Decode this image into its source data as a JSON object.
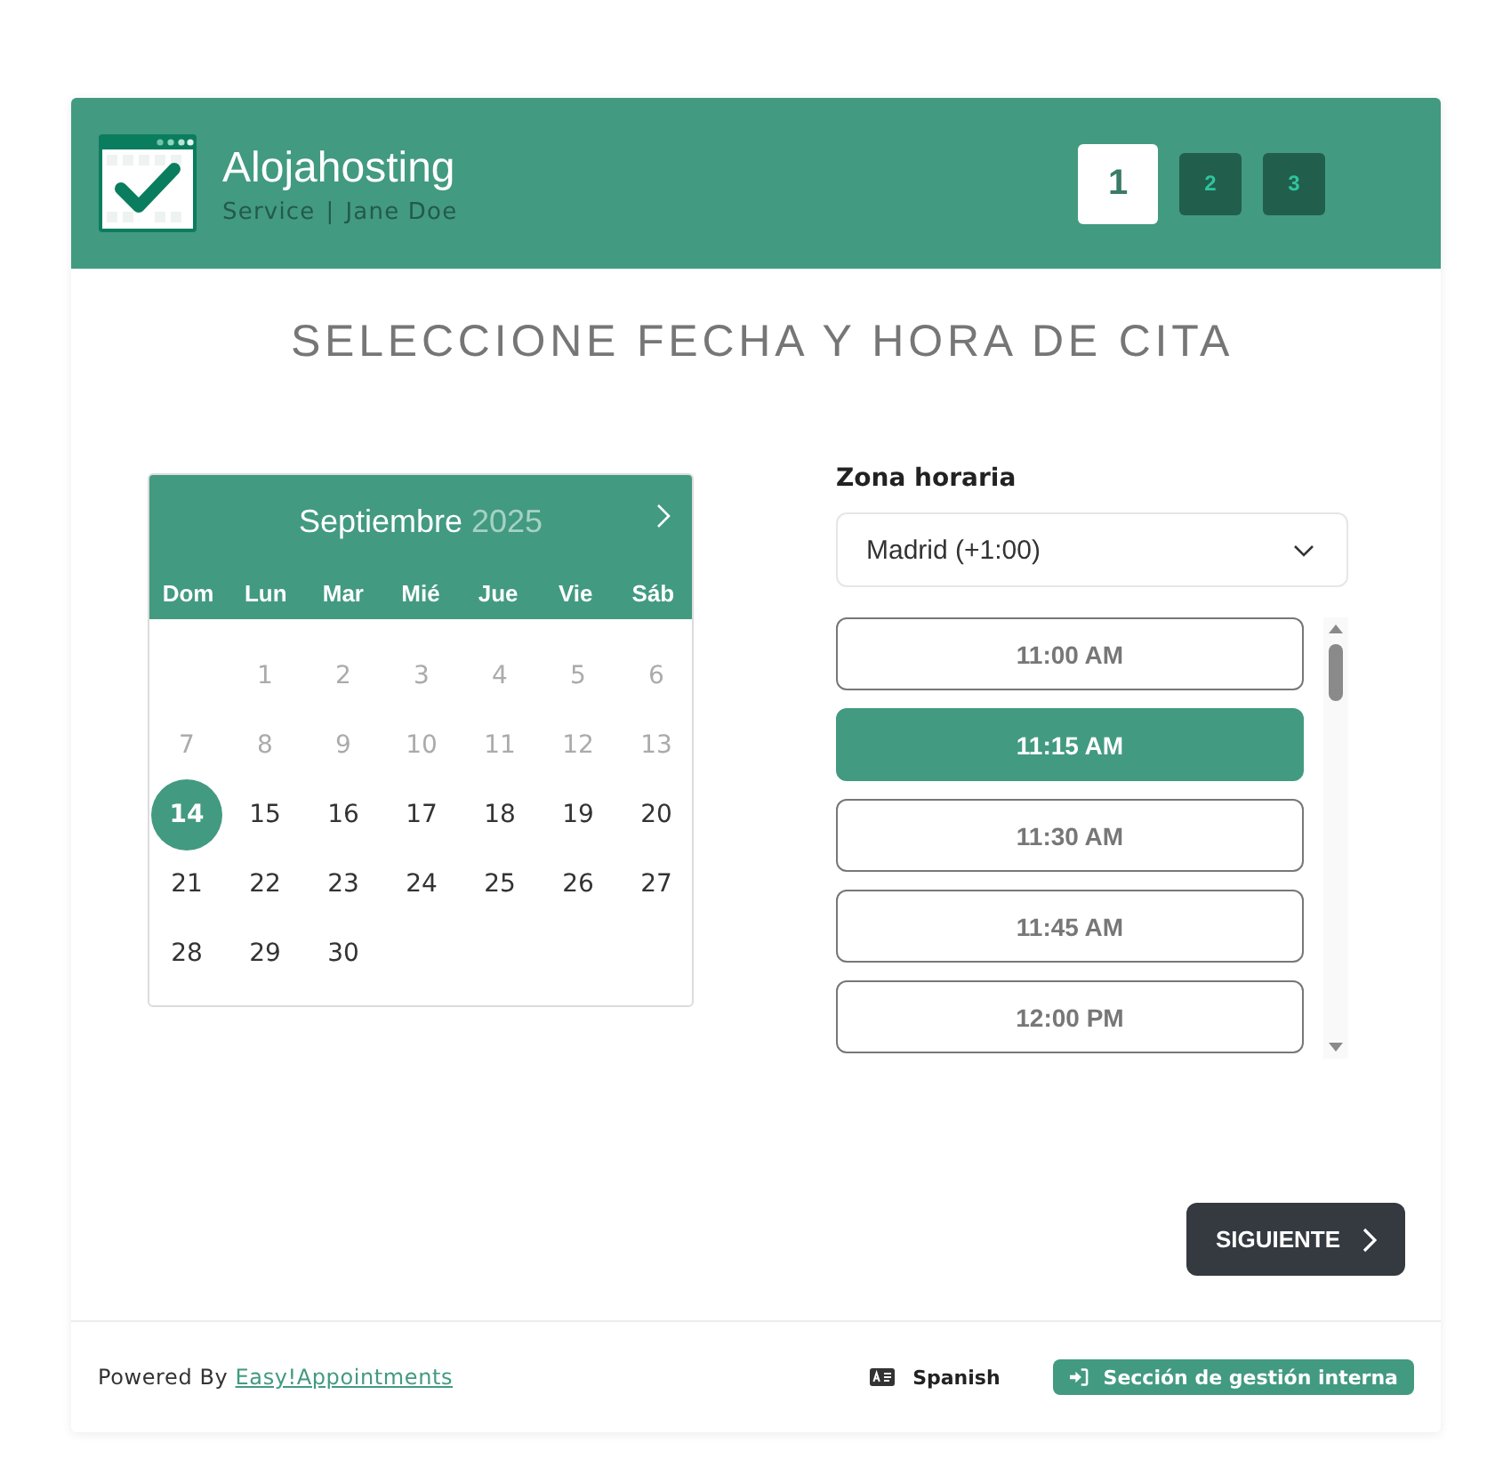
{
  "header": {
    "company": "Alojahosting",
    "service": "Service",
    "separator": "|",
    "provider": "Jane Doe",
    "steps": [
      {
        "label": "1",
        "selected": true
      },
      {
        "label": "2",
        "selected": false
      },
      {
        "label": "3",
        "selected": false
      }
    ]
  },
  "title": "SELECCIONE FECHA Y HORA DE CITA",
  "calendar": {
    "month": "Septiembre",
    "year": "2025",
    "weekdays": [
      "Dom",
      "Lun",
      "Mar",
      "Mié",
      "Jue",
      "Vie",
      "Sáb"
    ],
    "weeks": [
      [
        {
          "kind": "blank"
        },
        {
          "kind": "day",
          "label": "1",
          "disabled": true,
          "selected": false
        },
        {
          "kind": "day",
          "label": "2",
          "disabled": true,
          "selected": false
        },
        {
          "kind": "day",
          "label": "3",
          "disabled": true,
          "selected": false
        },
        {
          "kind": "day",
          "label": "4",
          "disabled": true,
          "selected": false
        },
        {
          "kind": "day",
          "label": "5",
          "disabled": true,
          "selected": false
        },
        {
          "kind": "day",
          "label": "6",
          "disabled": true,
          "selected": false
        }
      ],
      [
        {
          "kind": "day",
          "label": "7",
          "disabled": true,
          "selected": false
        },
        {
          "kind": "day",
          "label": "8",
          "disabled": true,
          "selected": false
        },
        {
          "kind": "day",
          "label": "9",
          "disabled": true,
          "selected": false
        },
        {
          "kind": "day",
          "label": "10",
          "disabled": true,
          "selected": false
        },
        {
          "kind": "day",
          "label": "11",
          "disabled": true,
          "selected": false
        },
        {
          "kind": "day",
          "label": "12",
          "disabled": true,
          "selected": false
        },
        {
          "kind": "day",
          "label": "13",
          "disabled": true,
          "selected": false
        }
      ],
      [
        {
          "kind": "day",
          "label": "14",
          "disabled": false,
          "selected": true
        },
        {
          "kind": "day",
          "label": "15",
          "disabled": false,
          "selected": false
        },
        {
          "kind": "day",
          "label": "16",
          "disabled": false,
          "selected": false
        },
        {
          "kind": "day",
          "label": "17",
          "disabled": false,
          "selected": false
        },
        {
          "kind": "day",
          "label": "18",
          "disabled": false,
          "selected": false
        },
        {
          "kind": "day",
          "label": "19",
          "disabled": false,
          "selected": false
        },
        {
          "kind": "day",
          "label": "20",
          "disabled": false,
          "selected": false
        }
      ],
      [
        {
          "kind": "day",
          "label": "21",
          "disabled": false,
          "selected": false
        },
        {
          "kind": "day",
          "label": "22",
          "disabled": false,
          "selected": false
        },
        {
          "kind": "day",
          "label": "23",
          "disabled": false,
          "selected": false
        },
        {
          "kind": "day",
          "label": "24",
          "disabled": false,
          "selected": false
        },
        {
          "kind": "day",
          "label": "25",
          "disabled": false,
          "selected": false
        },
        {
          "kind": "day",
          "label": "26",
          "disabled": false,
          "selected": false
        },
        {
          "kind": "day",
          "label": "27",
          "disabled": false,
          "selected": false
        }
      ],
      [
        {
          "kind": "day",
          "label": "28",
          "disabled": false,
          "selected": false
        },
        {
          "kind": "day",
          "label": "29",
          "disabled": false,
          "selected": false
        },
        {
          "kind": "day",
          "label": "30",
          "disabled": false,
          "selected": false
        }
      ]
    ]
  },
  "timezone": {
    "label": "Zona horaria",
    "value": "Madrid (+1:00)"
  },
  "slots": [
    {
      "label": "11:00 AM",
      "selected": false
    },
    {
      "label": "11:15 AM",
      "selected": true
    },
    {
      "label": "11:30 AM",
      "selected": false
    },
    {
      "label": "11:45 AM",
      "selected": false
    },
    {
      "label": "12:00 PM",
      "selected": false
    }
  ],
  "next_button": "SIGUIENTE",
  "footer": {
    "powered_by": "Powered By",
    "link": "Easy!Appointments",
    "language": "Spanish",
    "backend_button": "Sección de gestión interna"
  }
}
